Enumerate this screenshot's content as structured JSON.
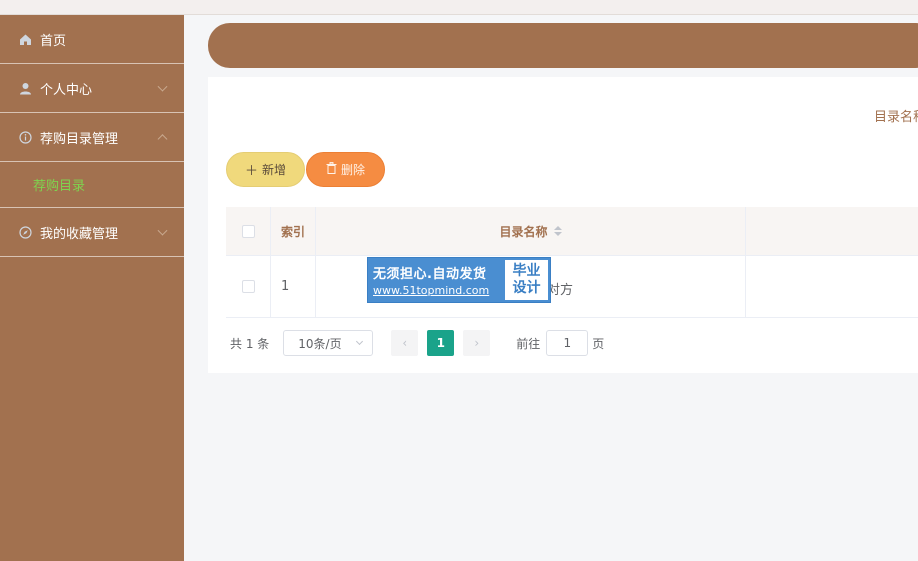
{
  "sidebar": {
    "items": [
      {
        "label": "首页",
        "icon": "home-icon"
      },
      {
        "label": "个人中心",
        "icon": "user-icon"
      },
      {
        "label": "荐购目录管理",
        "icon": "info-icon"
      },
      {
        "label": "我的收藏管理",
        "icon": "compass-icon"
      }
    ],
    "sub_items": [
      {
        "label": "荐购目录"
      }
    ]
  },
  "search": {
    "label": "目录名称"
  },
  "toolbar": {
    "add_label": "新增",
    "delete_label": "删除"
  },
  "table": {
    "headers": {
      "index": "索引",
      "name": "目录名称"
    },
    "rows": [
      {
        "index": "1",
        "name_visible": "对方"
      }
    ]
  },
  "pagination": {
    "total": "共 1 条",
    "page_size": "10条/页",
    "current_page": "1",
    "goto_label": "前往",
    "goto_value": "1",
    "page_suffix": "页"
  },
  "watermark": {
    "line1": "无须担心.自动发货",
    "line2": "www.51topmind.com",
    "badge1": "毕业",
    "badge2": "设计"
  },
  "colors": {
    "sidebar": "#a2714f",
    "accent_green": "#7fd44f",
    "add_button": "#f0d97c",
    "delete_button": "#f58c42",
    "page_active": "#1aa38a"
  }
}
